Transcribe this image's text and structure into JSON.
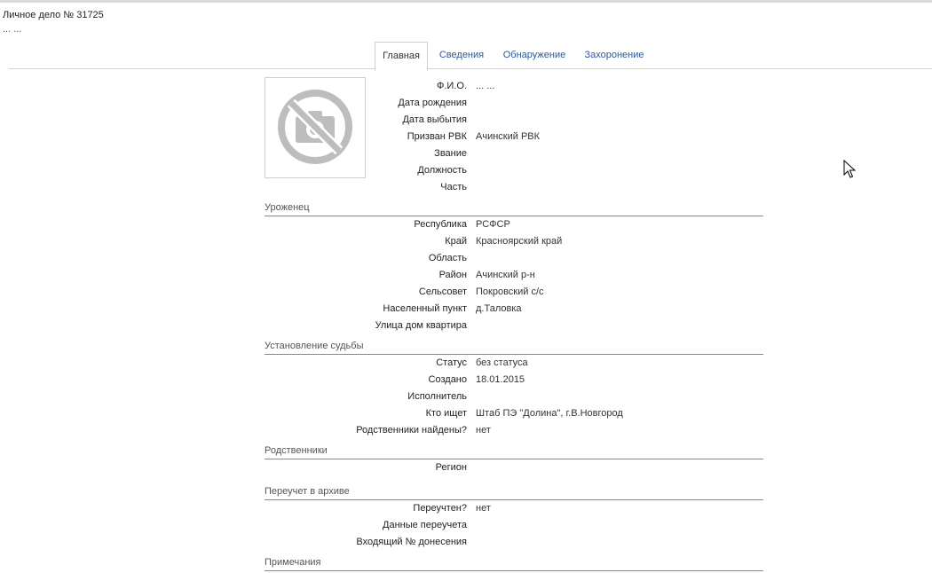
{
  "header": {
    "title": "Личное дело № 31725",
    "subtitle": "... ..."
  },
  "tabs": [
    {
      "label": "Главная",
      "active": true
    },
    {
      "label": "Сведения",
      "active": false
    },
    {
      "label": "Обнаружение",
      "active": false
    },
    {
      "label": "Захоронение",
      "active": false
    }
  ],
  "photo": {
    "icon": "no-photo-icon"
  },
  "main_fields": [
    {
      "label": "Ф.И.О.",
      "value": "... ..."
    },
    {
      "label": "Дата рождения",
      "value": ""
    },
    {
      "label": "Дата выбытия",
      "value": ""
    },
    {
      "label": "Призван РВК",
      "value": "Ачинский РВК"
    },
    {
      "label": "Звание",
      "value": ""
    },
    {
      "label": "Должность",
      "value": ""
    },
    {
      "label": "Часть",
      "value": ""
    }
  ],
  "sections": {
    "native": {
      "title": "Уроженец",
      "fields": [
        {
          "label": "Республика",
          "value": "РСФСР"
        },
        {
          "label": "Край",
          "value": "Красноярский край"
        },
        {
          "label": "Область",
          "value": ""
        },
        {
          "label": "Район",
          "value": "Ачинский р-н"
        },
        {
          "label": "Сельсовет",
          "value": "Покровский с/с"
        },
        {
          "label": "Населенный пункт",
          "value": "д.Таловка"
        },
        {
          "label": "Улица дом квартира",
          "value": ""
        }
      ]
    },
    "fate": {
      "title": "Установление судьбы",
      "fields": [
        {
          "label": "Статус",
          "value": "без статуса"
        },
        {
          "label": "Создано",
          "value": "18.01.2015"
        },
        {
          "label": "Исполнитель",
          "value": ""
        },
        {
          "label": "Кто ищет",
          "value": "Штаб ПЭ \"Долина\", г.В.Новгород"
        },
        {
          "label": "Родственники найдены?",
          "value": "нет"
        }
      ]
    },
    "relatives": {
      "title": "Родственники",
      "fields": [
        {
          "label": "Регион",
          "value": ""
        }
      ]
    },
    "archive": {
      "title": "Переучет в архиве",
      "fields": [
        {
          "label": "Переучтен?",
          "value": "нет"
        },
        {
          "label": "Данные переучета",
          "value": ""
        },
        {
          "label": "Входящий № донесения",
          "value": ""
        }
      ]
    },
    "notes": {
      "title": "Примечания"
    }
  },
  "colors": {
    "link": "#2a5a9a",
    "icon_gray": "#bdbdbd",
    "rule": "#8a8a8a"
  }
}
